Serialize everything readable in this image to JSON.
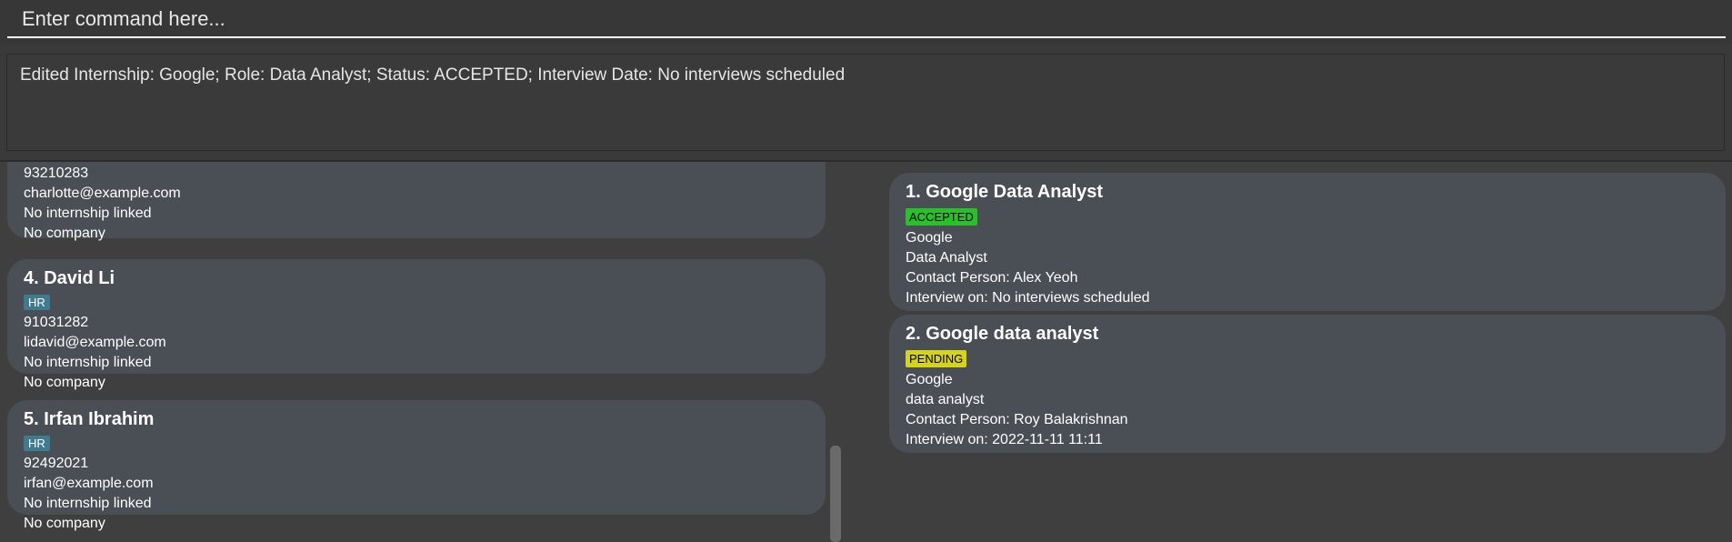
{
  "command": {
    "placeholder": "Enter command here..."
  },
  "result": {
    "text": "Edited Internship: Google; Role: Data Analyst; Status: ACCEPTED; Interview Date: No interviews scheduled"
  },
  "persons": [
    {
      "title": "",
      "tag": "",
      "phone": "93210283",
      "email": "charlotte@example.com",
      "internship": "No internship linked",
      "company": "No company"
    },
    {
      "title": "4.  David Li",
      "tag": "HR",
      "phone": "91031282",
      "email": "lidavid@example.com",
      "internship": "No internship linked",
      "company": "No company"
    },
    {
      "title": "5.  Irfan Ibrahim",
      "tag": "HR",
      "phone": "92492021",
      "email": "irfan@example.com",
      "internship": "No internship linked",
      "company": "No company"
    }
  ],
  "internships": [
    {
      "title": "1.  Google Data Analyst",
      "status": "ACCEPTED",
      "status_color": "#27c227",
      "company": "Google",
      "role": "Data Analyst",
      "contact": "Contact Person: Alex Yeoh",
      "interview": "Interview on: No interviews scheduled"
    },
    {
      "title": "2.  Google data analyst",
      "status": "PENDING",
      "status_color": "#d7d317",
      "company": "Google",
      "role": "data analyst",
      "contact": "Contact Person: Roy Balakrishnan",
      "interview": "Interview on: 2022-11-11 11:11"
    }
  ]
}
